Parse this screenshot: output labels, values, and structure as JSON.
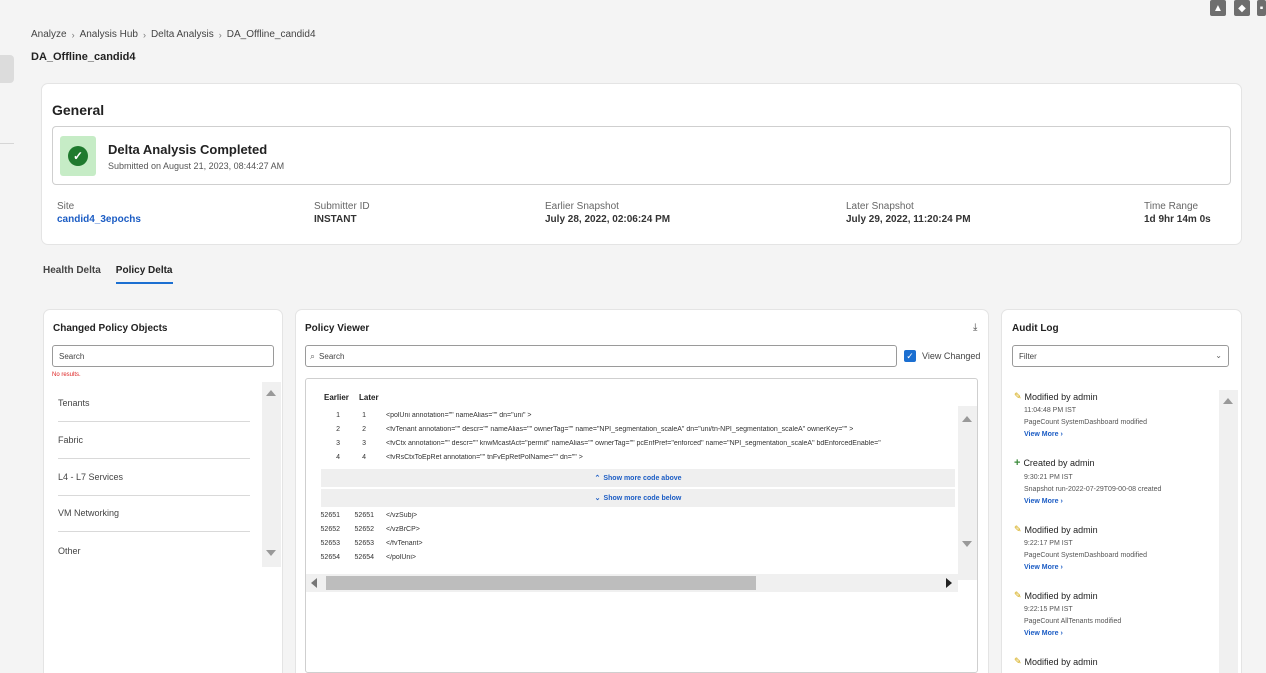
{
  "breadcrumb": [
    "Analyze",
    "Analysis Hub",
    "Delta Analysis",
    "DA_Offline_candid4"
  ],
  "page_title": "DA_Offline_candid4",
  "general": {
    "title": "General",
    "status_title": "Delta Analysis Completed",
    "status_sub": "Submitted on August 21, 2023, 08:44:27 AM",
    "meta": [
      {
        "label": "Site",
        "value": "candid4_3epochs"
      },
      {
        "label": "Submitter ID",
        "value": "INSTANT"
      },
      {
        "label": "Earlier Snapshot",
        "value": "July 28, 2022, 02:06:24 PM"
      },
      {
        "label": "Later Snapshot",
        "value": "July 29, 2022, 11:20:24 PM"
      },
      {
        "label": "Time Range",
        "value": "1d 9hr 14m 0s"
      }
    ]
  },
  "tabs": [
    "Health Delta",
    "Policy Delta"
  ],
  "changed_objects": {
    "title": "Changed Policy Objects",
    "search_placeholder": "Search",
    "no_results": "No results.",
    "items": [
      "Tenants",
      "Fabric",
      "L4 - L7 Services",
      "VM Networking",
      "Other"
    ]
  },
  "policy_viewer": {
    "title": "Policy Viewer",
    "search_placeholder": "Search",
    "view_changed_label": "View Changed",
    "col_earlier": "Earlier",
    "col_later": "Later",
    "top_lines": [
      {
        "earlier": "1",
        "later": "1",
        "text": "<polUni annotation=\"\" nameAlias=\"\" dn=\"uni\" >"
      },
      {
        "earlier": "2",
        "later": "2",
        "text": "<fvTenant annotation=\"\" descr=\"\" nameAlias=\"\" ownerTag=\"\" name=\"NPI_segmentation_scaleA\" dn=\"uni/tn-NPI_segmentation_scaleA\" ownerKey=\"\" >"
      },
      {
        "earlier": "3",
        "later": "3",
        "text": "<fvCtx annotation=\"\" descr=\"\" knwMcastAct=\"permit\" nameAlias=\"\" ownerTag=\"\" pcEnfPref=\"enforced\" name=\"NPI_segmentation_scaleA\" bdEnforcedEnable=\""
      },
      {
        "earlier": "4",
        "later": "4",
        "text": "<fvRsCtxToEpRet annotation=\"\" tnFvEpRetPolName=\"\" dn=\"\" >"
      }
    ],
    "show_above": "Show more code above",
    "show_below": "Show more code below",
    "bottom_lines": [
      {
        "earlier": "52651",
        "later": "52651",
        "text": "</vzSubj>"
      },
      {
        "earlier": "52652",
        "later": "52652",
        "text": "</vzBrCP>"
      },
      {
        "earlier": "52653",
        "later": "52653",
        "text": "</fvTenant>"
      },
      {
        "earlier": "52654",
        "later": "52654",
        "text": "</polUni>"
      }
    ]
  },
  "audit_log": {
    "title": "Audit Log",
    "filter_placeholder": "Filter",
    "entries": [
      {
        "icon": "pencil-icon",
        "title": "Modified by admin",
        "time": "11:04:48 PM IST",
        "desc": "PageCount SystemDashboard modified",
        "more": "View More"
      },
      {
        "icon": "plus-icon",
        "title": "Created by admin",
        "time": "9:30:21 PM IST",
        "desc": "Snapshot run-2022-07-29T09-00-08 created",
        "more": "View More"
      },
      {
        "icon": "pencil-icon",
        "title": "Modified by admin",
        "time": "9:22:17 PM IST",
        "desc": "PageCount SystemDashboard modified",
        "more": "View More"
      },
      {
        "icon": "pencil-icon",
        "title": "Modified by admin",
        "time": "9:22:15 PM IST",
        "desc": "PageCount AllTenants modified",
        "more": "View More"
      },
      {
        "icon": "pencil-icon",
        "title": "Modified by admin",
        "time": "",
        "desc": "",
        "more": ""
      }
    ]
  }
}
